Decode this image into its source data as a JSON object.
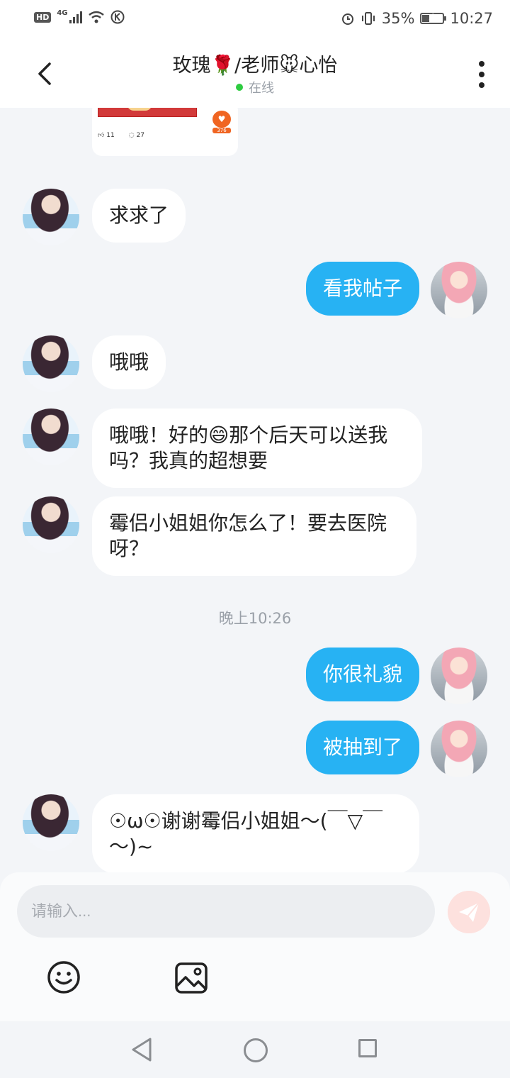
{
  "status_bar": {
    "network": "HD",
    "network_type": "4G",
    "battery": "35%",
    "battery_level": 0.35,
    "time": "10:27"
  },
  "header": {
    "title": "玫瑰🌹/老师🐭心怡",
    "status": "在线"
  },
  "shared_post": {
    "likes": "11",
    "comments": "27",
    "badge_count": "376"
  },
  "messages": [
    {
      "side": "in",
      "text": "求求了"
    },
    {
      "side": "out",
      "text": "看我帖子"
    },
    {
      "side": "in",
      "text": "哦哦"
    },
    {
      "side": "in",
      "text": "哦哦！好的😄那个后天可以送我吗？我真的超想要"
    },
    {
      "side": "in",
      "text": "霉侣小姐姐你怎么了！要去医院呀？"
    },
    {
      "side": "out",
      "text": "你很礼貌"
    },
    {
      "side": "out",
      "text": "被抽到了"
    },
    {
      "side": "in",
      "text": "☉ω☉谢谢霉侣小姐姐～(￣▽￣～)~"
    }
  ],
  "timestamp": "晚上10:26",
  "input": {
    "placeholder": "请输入..."
  },
  "icons": [
    "back-icon",
    "more-icon",
    "send-icon",
    "emoji-icon",
    "image-icon",
    "nav-back-icon",
    "nav-home-icon",
    "nav-recent-icon"
  ],
  "colors": {
    "outgoing_bubble": "#27b2f3",
    "incoming_bubble": "#ffffff",
    "background": "#f3f5f8",
    "online_dot": "#2ecc40",
    "send_button": "#fde1de"
  }
}
